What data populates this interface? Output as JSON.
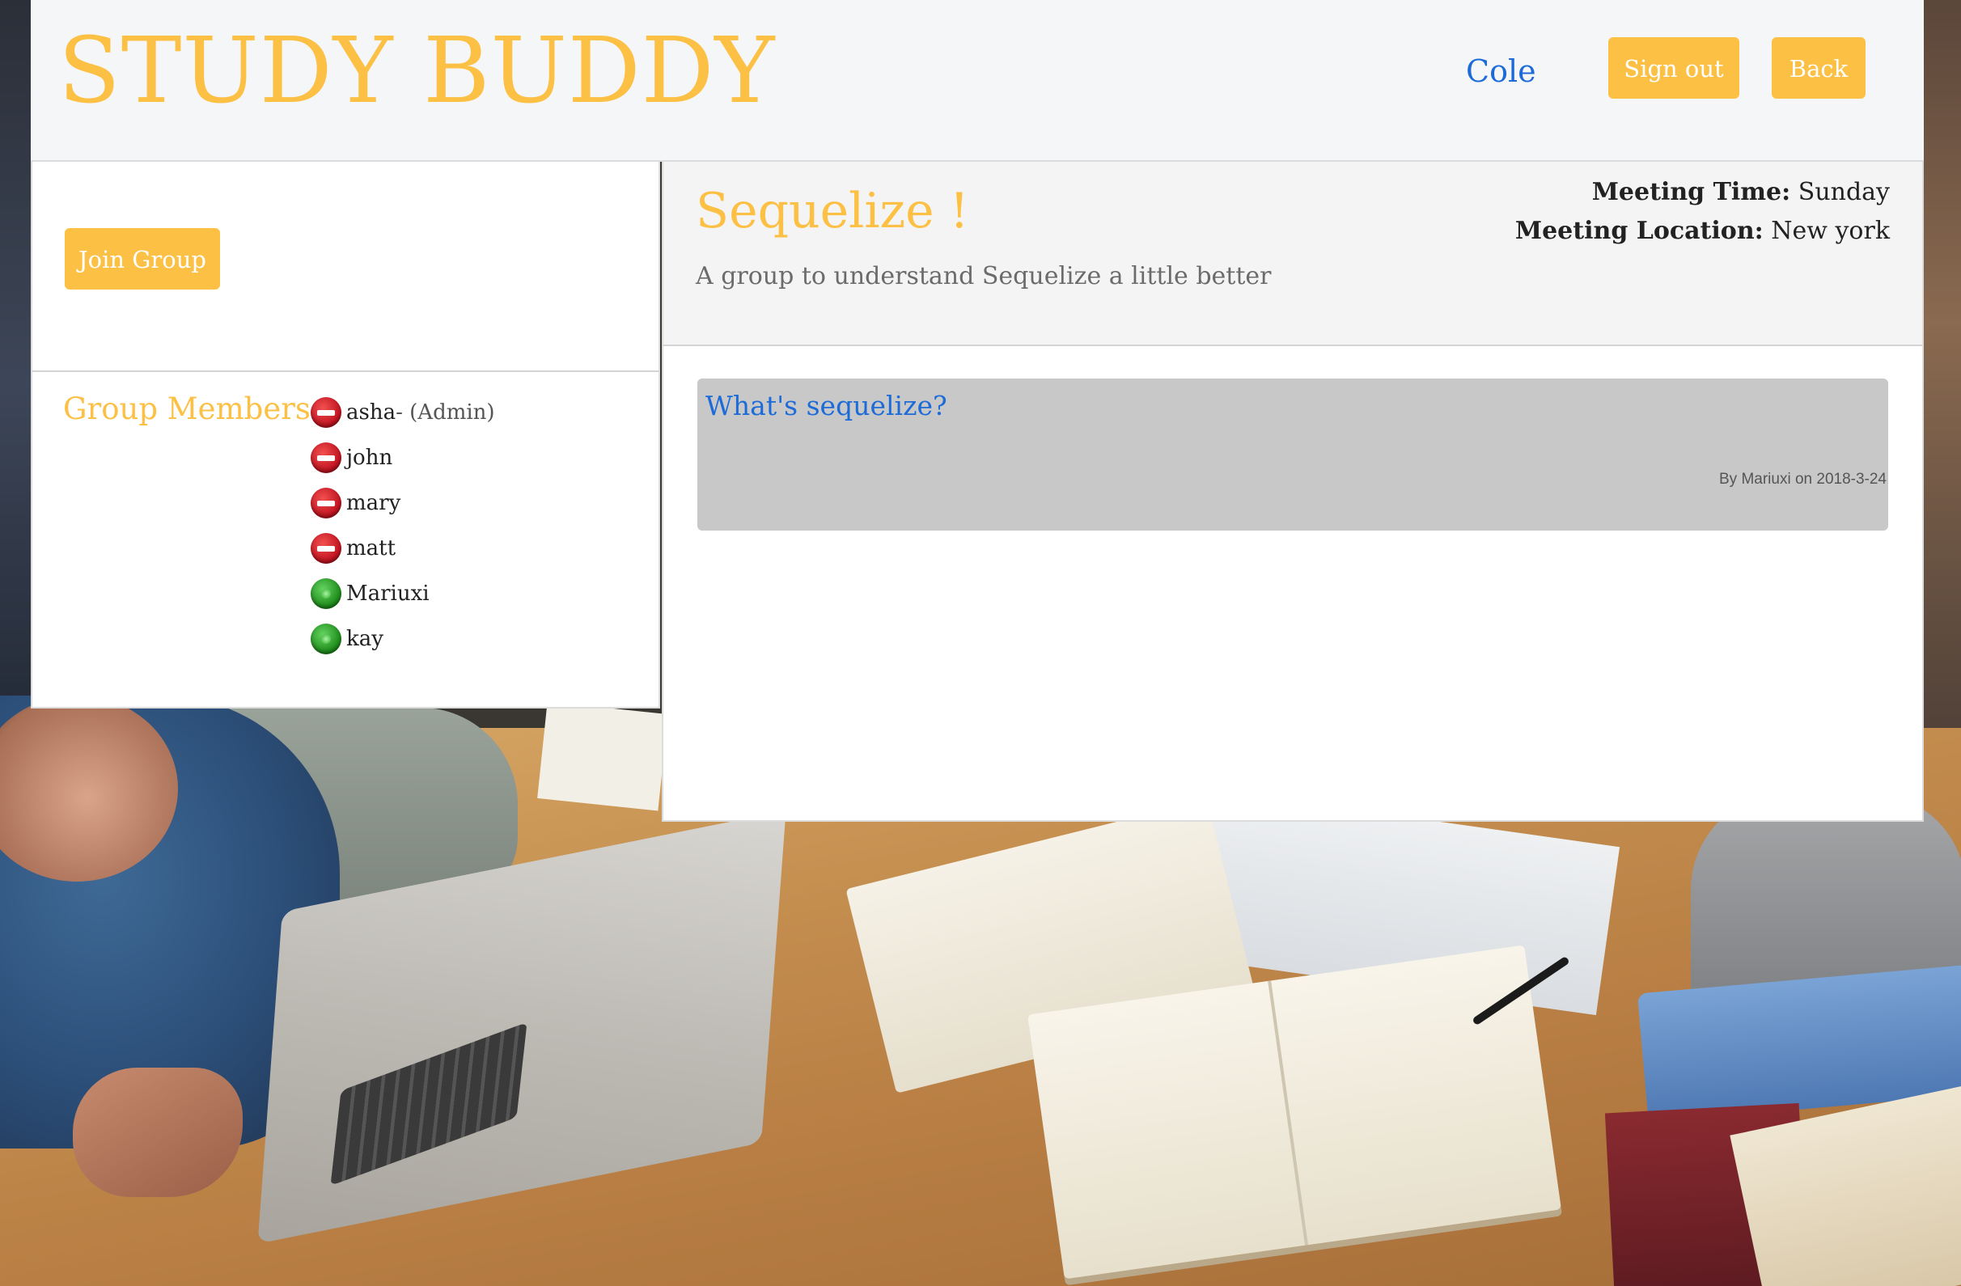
{
  "header": {
    "brand": "STUDY BUDDY",
    "user": "Cole",
    "signout_label": "Sign out",
    "back_label": "Back"
  },
  "sidebar": {
    "join_label": "Join Group",
    "members_title": "Group Members",
    "members": [
      {
        "name": "asha",
        "suffix": " - (Admin)",
        "status": "offline"
      },
      {
        "name": "john",
        "suffix": "",
        "status": "offline"
      },
      {
        "name": "mary",
        "suffix": "",
        "status": "offline"
      },
      {
        "name": "matt",
        "suffix": "",
        "status": "offline"
      },
      {
        "name": "Mariuxi",
        "suffix": "",
        "status": "online"
      },
      {
        "name": "kay",
        "suffix": "",
        "status": "online"
      }
    ]
  },
  "group": {
    "title": "Sequelize !",
    "description": "A group to understand Sequelize a little better",
    "meeting_time_label": "Meeting Time:",
    "meeting_time": "Sunday",
    "meeting_location_label": "Meeting Location:",
    "meeting_location": "New york"
  },
  "posts": [
    {
      "title": "What's sequelize?",
      "meta": "By Mariuxi on 2018-3-24"
    }
  ],
  "colors": {
    "accent": "#fcc045",
    "link": "#1c6bd8",
    "online": "#1f8c1c",
    "offline": "#c01420"
  }
}
